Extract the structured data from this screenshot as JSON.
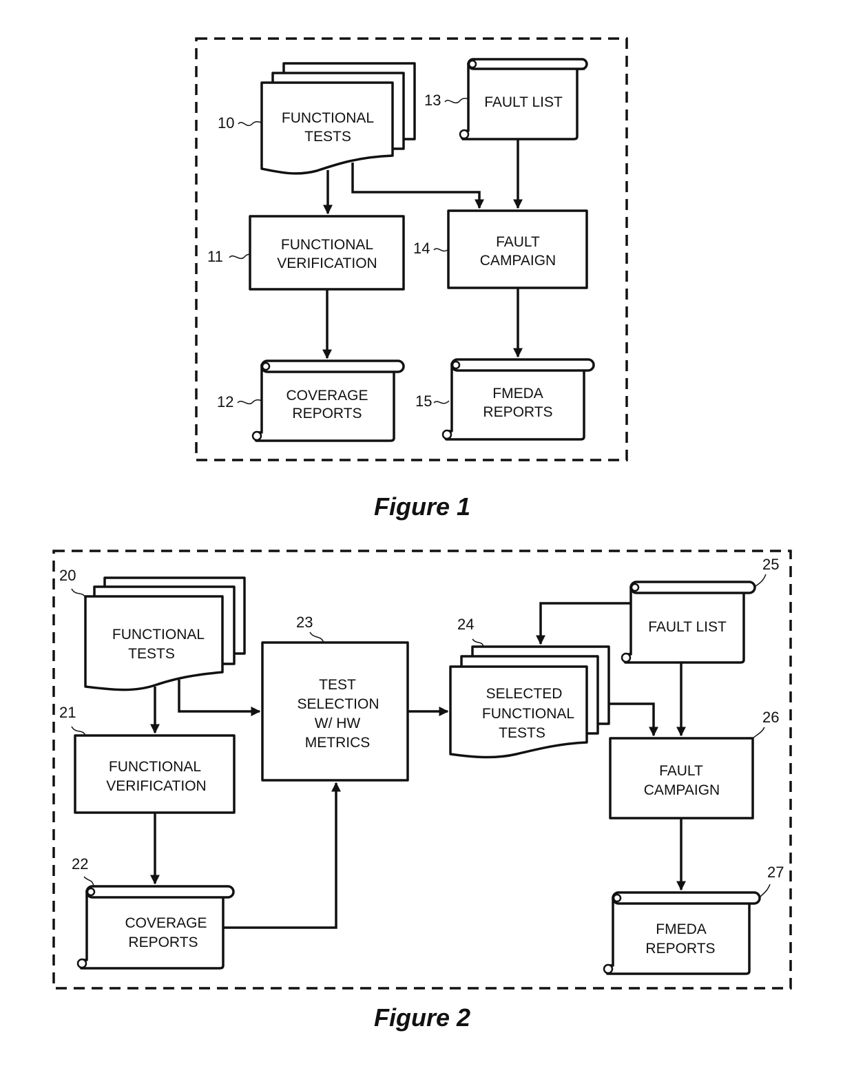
{
  "figure1": {
    "caption": "Figure 1",
    "nodes": {
      "functional_tests": {
        "ref": "10",
        "lines": [
          "FUNCTIONAL",
          "TESTS"
        ]
      },
      "functional_verification": {
        "ref": "11",
        "lines": [
          "FUNCTIONAL",
          "VERIFICATION"
        ]
      },
      "coverage_reports": {
        "ref": "12",
        "lines": [
          "COVERAGE",
          "REPORTS"
        ]
      },
      "fault_list": {
        "ref": "13",
        "lines": [
          "FAULT LIST"
        ]
      },
      "fault_campaign": {
        "ref": "14",
        "lines": [
          "FAULT",
          "CAMPAIGN"
        ]
      },
      "fmeda_reports": {
        "ref": "15",
        "lines": [
          "FMEDA",
          "REPORTS"
        ]
      }
    }
  },
  "figure2": {
    "caption": "Figure 2",
    "nodes": {
      "functional_tests": {
        "ref": "20",
        "lines": [
          "FUNCTIONAL",
          "TESTS"
        ]
      },
      "functional_verification": {
        "ref": "21",
        "lines": [
          "FUNCTIONAL",
          "VERIFICATION"
        ]
      },
      "coverage_reports": {
        "ref": "22",
        "lines": [
          "COVERAGE",
          "REPORTS"
        ]
      },
      "test_selection": {
        "ref": "23",
        "lines": [
          "TEST",
          "SELECTION",
          "W/ HW",
          "METRICS"
        ]
      },
      "selected_functional_tests": {
        "ref": "24",
        "lines": [
          "SELECTED",
          "FUNCTIONAL",
          "TESTS"
        ]
      },
      "fault_list": {
        "ref": "25",
        "lines": [
          "FAULT LIST"
        ]
      },
      "fault_campaign": {
        "ref": "26",
        "lines": [
          "FAULT",
          "CAMPAIGN"
        ]
      },
      "fmeda_reports": {
        "ref": "27",
        "lines": [
          "FMEDA",
          "REPORTS"
        ]
      }
    }
  }
}
